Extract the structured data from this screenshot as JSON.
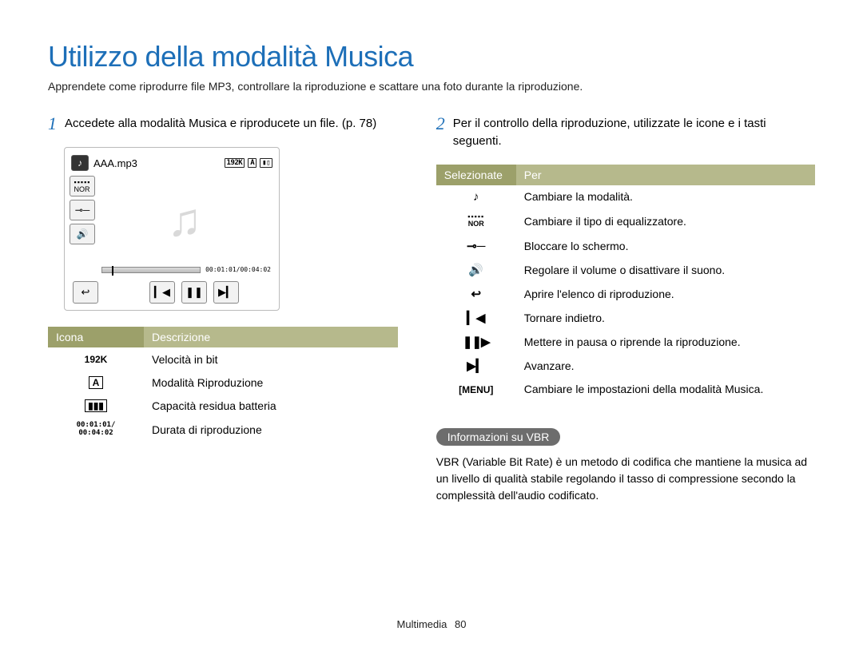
{
  "title": "Utilizzo della modalità Musica",
  "intro": "Apprendete come riprodurre file MP3, controllare la riproduzione e scattare una foto durante la riproduzione.",
  "step1": {
    "num": "1",
    "text": "Accedete alla modalità Musica e riproducete un file. (p. 78)"
  },
  "step2": {
    "num": "2",
    "text": "Per il controllo della riproduzione, utilizzate le icone e i tasti seguenti."
  },
  "player": {
    "file": "AAA.mp3",
    "bitrate": "192K",
    "playmode": "A",
    "time_elapsed": "00:01:01",
    "time_total": "00:04:02",
    "time_inline": "00:01:01/00:04:02"
  },
  "table_left": {
    "headers": {
      "icona": "Icona",
      "descr": "Descrizione"
    },
    "rows": [
      {
        "icon": "192K",
        "desc": "Velocità in bit"
      },
      {
        "icon": "A",
        "desc": "Modalità Riproduzione"
      },
      {
        "icon": "batt",
        "desc": "Capacità residua batteria"
      },
      {
        "icon": "time",
        "desc": "Durata di riproduzione"
      }
    ],
    "time_label": "00:01:01/\n00:04:02"
  },
  "table_right": {
    "headers": {
      "sel": "Selezionate",
      "per": "Per"
    },
    "rows": [
      {
        "icon": "note",
        "desc": "Cambiare la modalità."
      },
      {
        "icon": "nor",
        "desc": "Cambiare il tipo di equalizzatore."
      },
      {
        "icon": "key",
        "desc": "Bloccare lo schermo."
      },
      {
        "icon": "volume",
        "desc": "Regolare il volume o disattivare il suono."
      },
      {
        "icon": "back",
        "desc": "Aprire l'elenco di riproduzione."
      },
      {
        "icon": "prev",
        "desc": "Tornare indietro."
      },
      {
        "icon": "playpause",
        "desc": "Mettere in pausa o riprende la riproduzione."
      },
      {
        "icon": "next",
        "desc": "Avanzare."
      },
      {
        "icon": "[MENU]",
        "desc": "Cambiare le impostazioni della modalità Musica."
      }
    ]
  },
  "info": {
    "title": "Informazioni su VBR",
    "body": "VBR (Variable Bit Rate) è un metodo di codifica che mantiene la musica ad un livello di qualità stabile regolando il tasso di compressione secondo la complessità dell'audio codificato."
  },
  "footer": {
    "section": "Multimedia",
    "page": "80"
  }
}
